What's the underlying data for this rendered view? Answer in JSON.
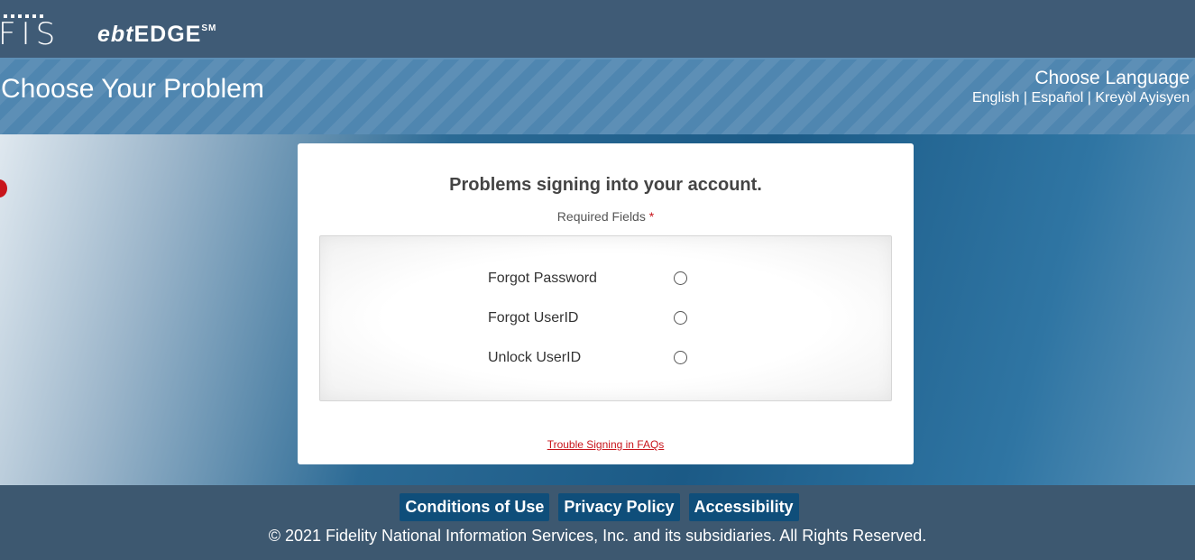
{
  "brand": {
    "logo_mark": "FIS",
    "product_prefix": "ebt",
    "product_name": "EDGE",
    "product_superscript": "SM"
  },
  "header": {
    "page_title": "Choose Your Problem",
    "language_title": "Choose Language",
    "languages": [
      "English",
      "Español",
      "Kreyòl Ayisyen"
    ],
    "separator": " | "
  },
  "card": {
    "heading": "Problems signing into your account.",
    "required_label": "Required Fields",
    "required_marker": "*",
    "options": [
      {
        "label": "Forgot Password",
        "selected": false
      },
      {
        "label": "Forgot UserID",
        "selected": false
      },
      {
        "label": "Unlock UserID",
        "selected": false
      }
    ],
    "faq_link": "Trouble Signing in FAQs"
  },
  "footer": {
    "links": [
      "Conditions of Use",
      "Privacy Policy",
      "Accessibility"
    ],
    "copyright": "© 2021 Fidelity National Information Services, Inc. and its subsidiaries. All Rights Reserved."
  },
  "colors": {
    "top_bar": "#3f5b76",
    "header_band": "#4f86b0",
    "footer": "#3d5870",
    "footer_button": "#0f4e7a",
    "accent_red": "#c8151b"
  }
}
